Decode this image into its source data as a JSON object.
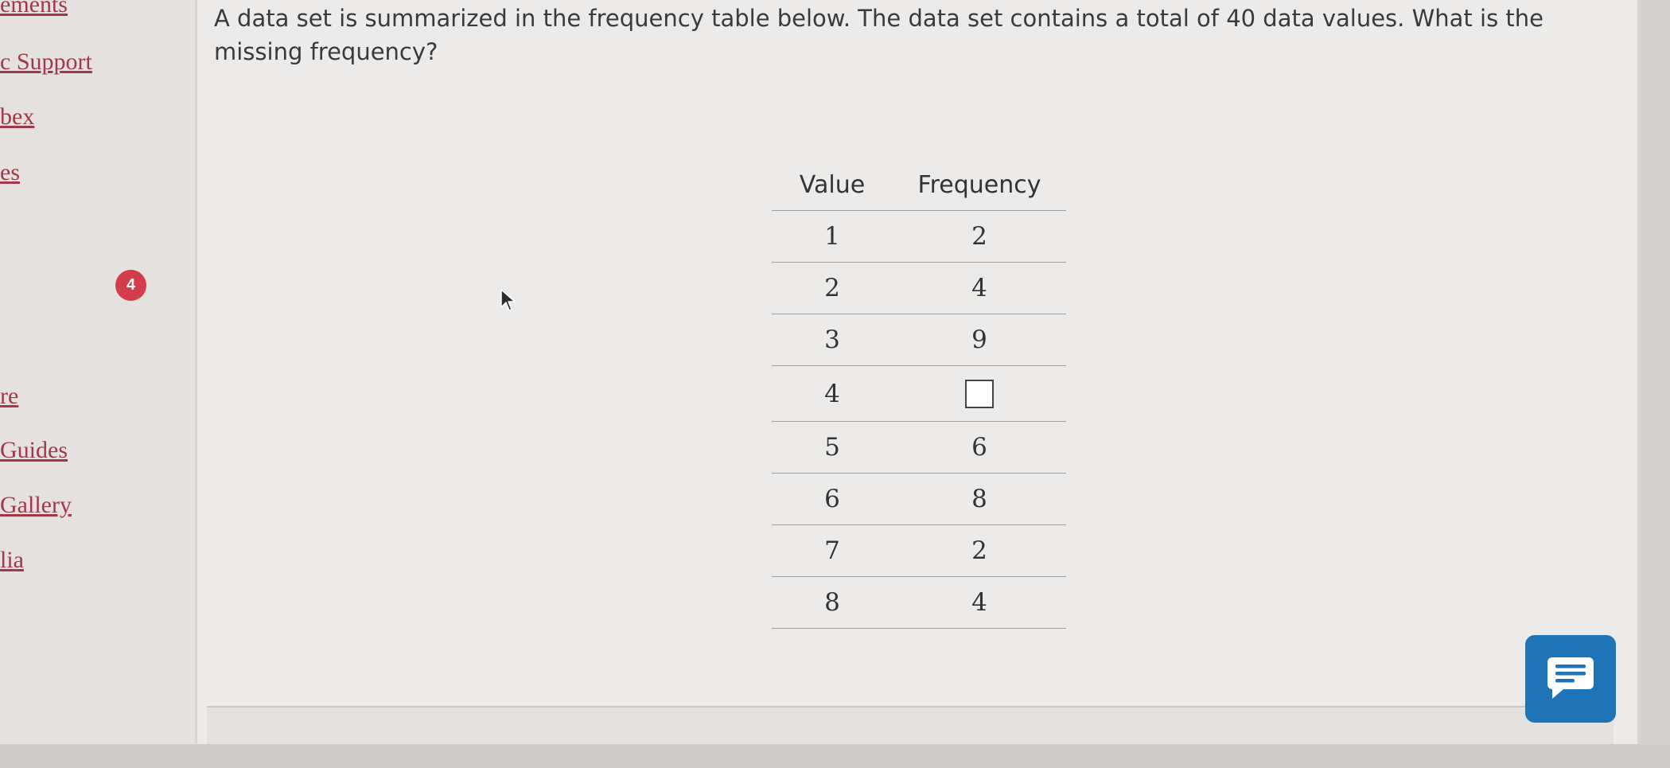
{
  "sidebar": {
    "links": [
      {
        "label": "ements"
      },
      {
        "label": "c Support"
      },
      {
        "label": "bex"
      },
      {
        "label": "es"
      },
      {
        "label": "re"
      },
      {
        "label": "Guides"
      },
      {
        "label": "Gallery"
      },
      {
        "label": "lia"
      }
    ],
    "badge_count": "4"
  },
  "question": {
    "text": "A data set is summarized in the frequency table below. The data set contains a total of 40 data values. What is the missing frequency?"
  },
  "table": {
    "headers": [
      "Value",
      "Frequency"
    ],
    "rows": [
      {
        "value": "1",
        "frequency": "2"
      },
      {
        "value": "2",
        "frequency": "4"
      },
      {
        "value": "3",
        "frequency": "9"
      },
      {
        "value": "4",
        "frequency": ""
      },
      {
        "value": "5",
        "frequency": "6"
      },
      {
        "value": "6",
        "frequency": "8"
      },
      {
        "value": "7",
        "frequency": "2"
      },
      {
        "value": "8",
        "frequency": "4"
      }
    ]
  },
  "colors": {
    "link": "#a33948",
    "badge": "#d23c4b",
    "chat_button": "#1f73b7"
  },
  "icons": {
    "cursor": "mouse-pointer-icon",
    "chat": "chat-icon"
  }
}
